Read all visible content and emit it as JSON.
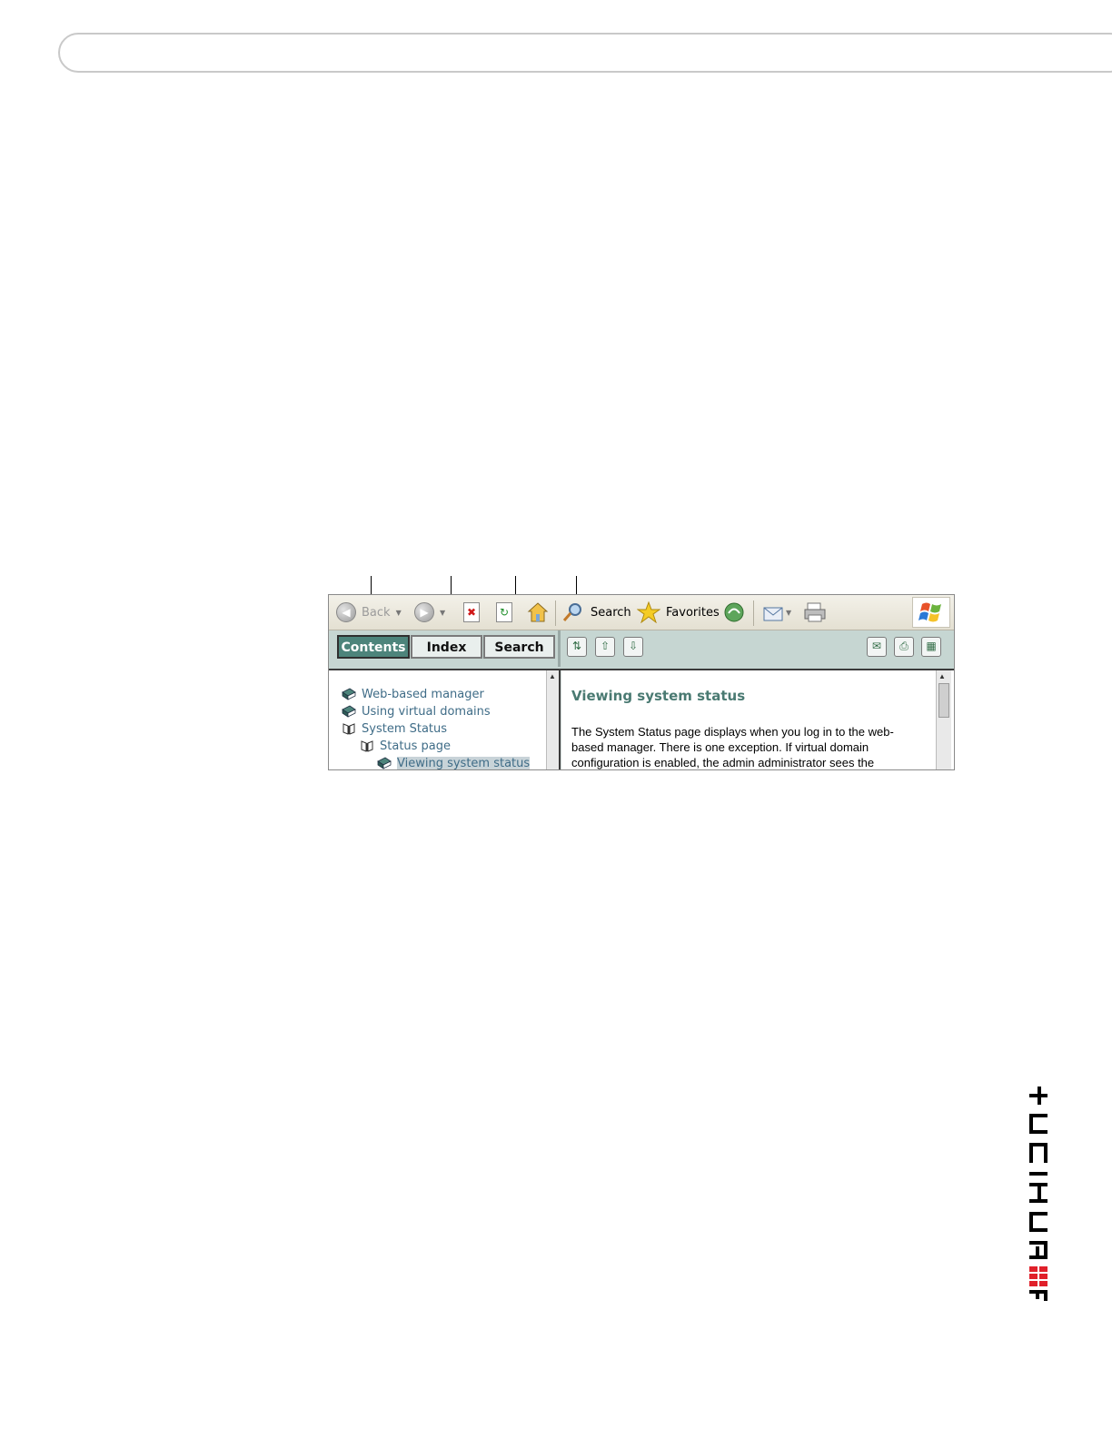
{
  "toolbar": {
    "back_label": "Back",
    "search_label": "Search",
    "favorites_label": "Favorites"
  },
  "tabs": [
    {
      "label": "Contents",
      "active": true
    },
    {
      "label": "Index",
      "active": false
    },
    {
      "label": "Search",
      "active": false
    }
  ],
  "toc": [
    {
      "label": "Web-based manager",
      "icon": "closed-book-icon"
    },
    {
      "label": "Using virtual domains",
      "icon": "closed-book-icon"
    },
    {
      "label": "System Status",
      "icon": "open-book-icon"
    },
    {
      "label": "Status page",
      "icon": "open-book-icon"
    },
    {
      "label": "Viewing system status",
      "icon": "topic-icon"
    }
  ],
  "topic": {
    "title": "Viewing system status",
    "lines": [
      "The System Status page displays when you log in to the web-",
      "based manager. There is one exception. If virtual domain",
      "configuration is enabled, the admin administrator sees the"
    ]
  },
  "logo_text": "FORTINET",
  "colors": {
    "tab_active": "#4d847b",
    "help_bar": "#c6d6d2",
    "toc_link": "#3f6c87",
    "topic_title": "#4a7a72",
    "logo_red": "#e0202a"
  }
}
